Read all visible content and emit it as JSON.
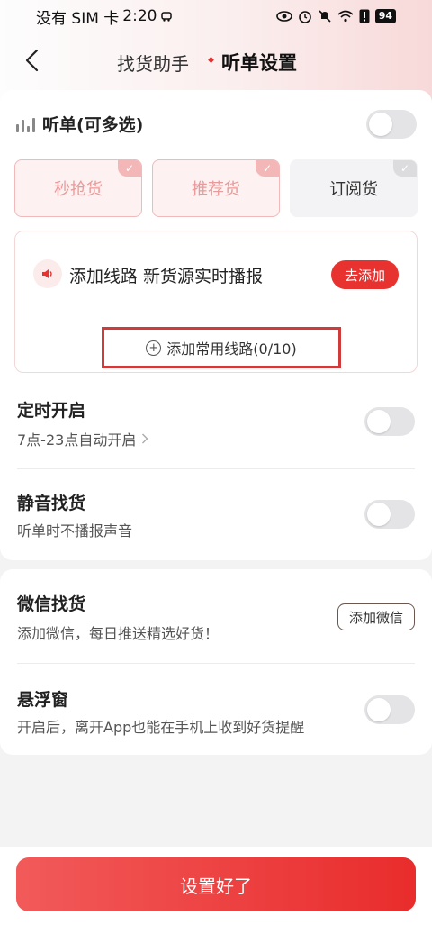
{
  "status_bar": {
    "carrier": "没有 SIM 卡",
    "time": "2:20",
    "battery": "94"
  },
  "nav": {
    "tabs": [
      {
        "label": "找货助手",
        "active": false
      },
      {
        "label": "听单设置",
        "active": true
      }
    ]
  },
  "listen": {
    "title": "听单(可多选)",
    "enabled": false,
    "options": [
      {
        "label": "秒抢货",
        "selected": true
      },
      {
        "label": "推荐货",
        "selected": true
      },
      {
        "label": "订阅货",
        "selected": false
      }
    ],
    "route_text": "添加线路 新货源实时播报",
    "go_add_label": "去添加",
    "add_route_label": "添加常用线路(0/10)"
  },
  "settings": {
    "timer": {
      "title": "定时开启",
      "sub": "7点-23点自动开启",
      "enabled": false
    },
    "mute": {
      "title": "静音找货",
      "sub": "听单时不播报声音",
      "enabled": false
    },
    "wechat": {
      "title": "微信找货",
      "sub": "添加微信，每日推送精选好货！",
      "button": "添加微信"
    },
    "floating": {
      "title": "悬浮窗",
      "sub": "开启后，离开App也能在手机上收到好货提醒",
      "enabled": false
    }
  },
  "footer": {
    "done_label": "设置好了"
  },
  "colors": {
    "accent": "#e8322f",
    "selected_chip_text": "#e99a9a"
  }
}
